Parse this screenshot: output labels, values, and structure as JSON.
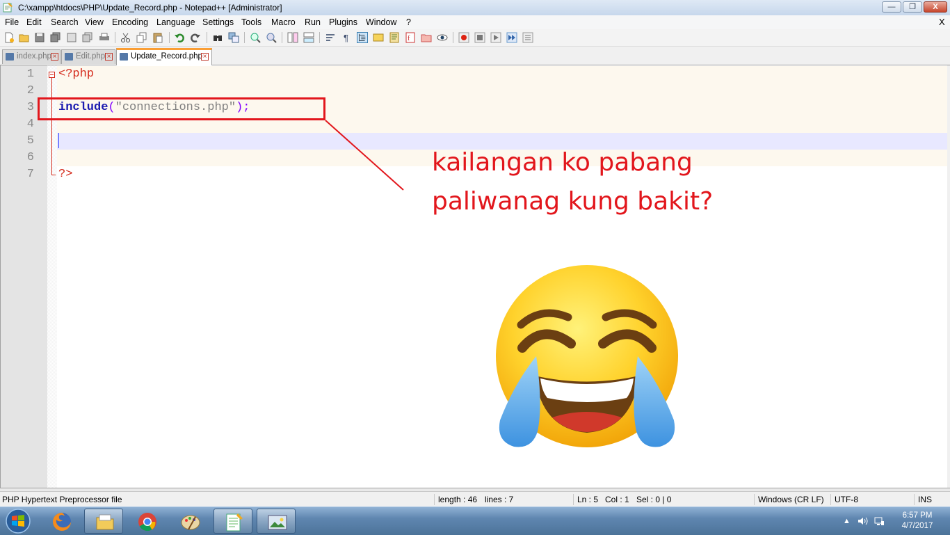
{
  "window": {
    "title": "C:\\xampp\\htdocs\\PHP\\Update_Record.php - Notepad++ [Administrator]",
    "minimize_glyph": "—",
    "maximize_glyph": "❐",
    "close_glyph": "X"
  },
  "menu": {
    "items": [
      "File",
      "Edit",
      "Search",
      "View",
      "Encoding",
      "Language",
      "Settings",
      "Tools",
      "Macro",
      "Run",
      "Plugins",
      "Window",
      "?"
    ],
    "close_doc": "X"
  },
  "toolbar": {
    "icons": [
      "new-file-icon",
      "open-file-icon",
      "save-icon",
      "save-all-icon",
      "close-icon",
      "close-all-icon",
      "print-icon",
      "cut-icon",
      "copy-icon",
      "paste-icon",
      "undo-icon",
      "redo-icon",
      "find-icon",
      "replace-icon",
      "zoom-in-icon",
      "zoom-out-icon",
      "sync-vertical-icon",
      "sync-horizontal-icon",
      "word-wrap-icon",
      "show-all-chars-icon",
      "indent-guide-icon",
      "user-language-icon",
      "doc-map-icon",
      "function-list-icon",
      "folder-workspace-icon",
      "monitor-icon",
      "record-macro-icon",
      "stop-macro-icon",
      "play-macro-icon",
      "run-macro-multiple-icon",
      "save-macro-icon"
    ]
  },
  "tabs": [
    {
      "label": "index.php",
      "active": false
    },
    {
      "label": "Edit.php",
      "active": false
    },
    {
      "label": "Update_Record.php",
      "active": true
    }
  ],
  "editor": {
    "line_numbers": [
      "1",
      "2",
      "3",
      "4",
      "5",
      "6",
      "7"
    ],
    "line1": "<?php",
    "line3_keyword": "include",
    "line3_open": "(",
    "line3_string": "\"connections.php\"",
    "line3_close": ");",
    "line7": "?>",
    "current_line": 5
  },
  "annotation": {
    "text": "kailangan ko pabang\npaliwanag kung bakit?",
    "color": "#e2161c",
    "emoji": "face-with-tears-of-joy"
  },
  "status": {
    "file_type": "PHP Hypertext Preprocessor file",
    "length": "length : 46",
    "lines": "lines : 7",
    "ln": "Ln : 5",
    "col": "Col : 1",
    "sel": "Sel : 0 | 0",
    "eol": "Windows (CR LF)",
    "encoding": "UTF-8",
    "mode": "INS"
  },
  "taskbar": {
    "apps": [
      "firefox-icon",
      "file-explorer-icon",
      "chrome-icon",
      "paint-icon",
      "notepad-plus-plus-icon",
      "photo-viewer-icon"
    ],
    "time": "6:57 PM",
    "date": "4/7/2017"
  }
}
